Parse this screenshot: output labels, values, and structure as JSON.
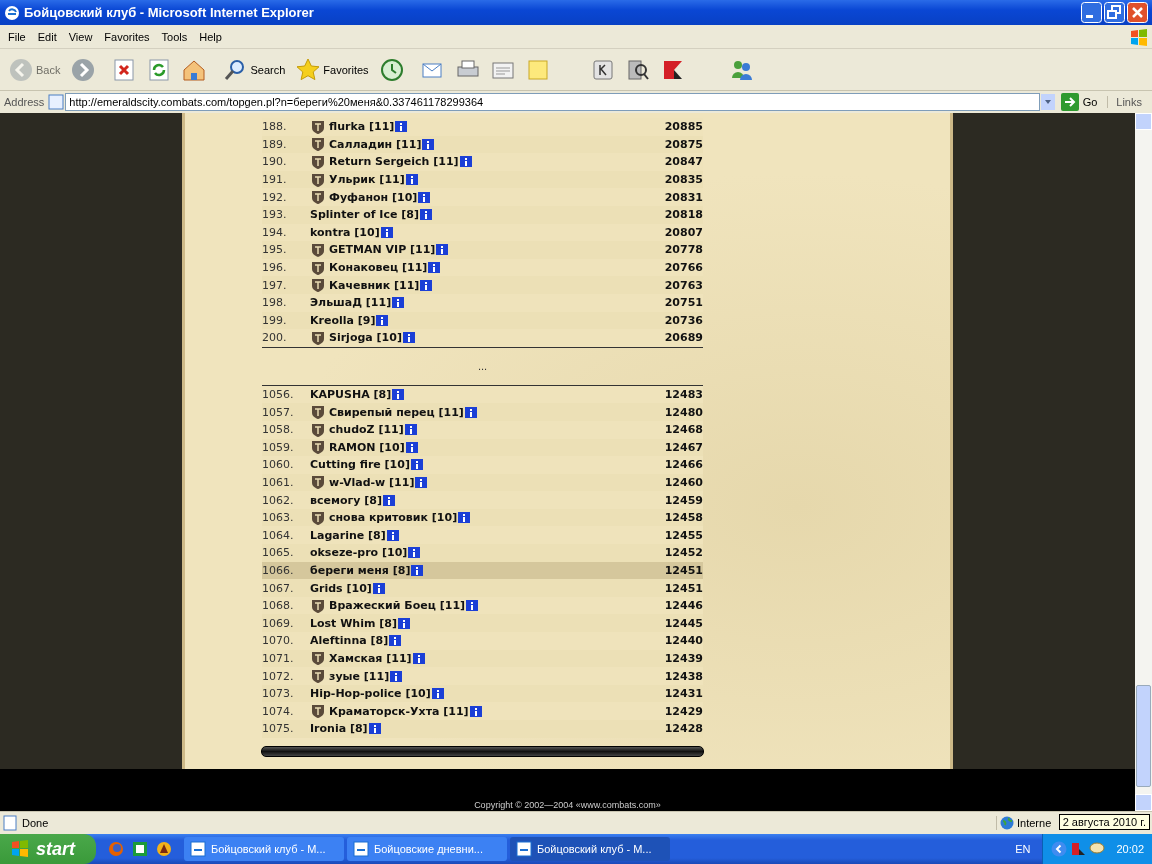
{
  "window": {
    "title": "Бойцовский клуб - Microsoft Internet Explorer"
  },
  "menu": [
    "File",
    "Edit",
    "View",
    "Favorites",
    "Tools",
    "Help"
  ],
  "toolbar": [
    {
      "kind": "back",
      "label": "Back",
      "disabled": true
    },
    {
      "kind": "forward",
      "disabled": false
    },
    {
      "kind": "stop",
      "disabled": false
    },
    {
      "kind": "refresh",
      "disabled": false
    },
    {
      "kind": "home",
      "disabled": false
    },
    {
      "kind": "search",
      "label": "Search",
      "disabled": false
    },
    {
      "kind": "favorites",
      "label": "Favorites",
      "disabled": false
    },
    {
      "kind": "history",
      "disabled": false
    },
    {
      "kind": "mail",
      "disabled": false
    },
    {
      "kind": "print",
      "disabled": false
    },
    {
      "kind": "edit",
      "disabled": false
    },
    {
      "kind": "note",
      "disabled": false
    },
    {
      "kind": "k",
      "disabled": false
    },
    {
      "kind": "magnifier",
      "disabled": false
    },
    {
      "kind": "antivirus",
      "disabled": false
    },
    {
      "kind": "messenger",
      "disabled": false
    }
  ],
  "address": {
    "label": "Address",
    "value": "http://emeraldscity.combats.com/topgen.pl?n=береги%20меня&0.337461178299364",
    "go": "Go",
    "links": "Links"
  },
  "ranking": {
    "top_rows": [
      {
        "rank": "188.",
        "name": "flurka [11]",
        "emblem": true,
        "selected": false,
        "score": "20885"
      },
      {
        "rank": "189.",
        "name": "Салладин [11]",
        "emblem": true,
        "selected": false,
        "score": "20875"
      },
      {
        "rank": "190.",
        "name": "Return Sergeich [11]",
        "emblem": true,
        "selected": false,
        "score": "20847"
      },
      {
        "rank": "191.",
        "name": "Ульрик [11]",
        "emblem": true,
        "selected": false,
        "score": "20835"
      },
      {
        "rank": "192.",
        "name": "Фуфанон [10]",
        "emblem": true,
        "selected": false,
        "score": "20831"
      },
      {
        "rank": "193.",
        "name": "Splinter of Ice [8]",
        "emblem": false,
        "selected": false,
        "score": "20818"
      },
      {
        "rank": "194.",
        "name": "kontra [10]",
        "emblem": false,
        "selected": false,
        "score": "20807"
      },
      {
        "rank": "195.",
        "name": "GETMAN VIP [11]",
        "emblem": true,
        "selected": false,
        "score": "20778"
      },
      {
        "rank": "196.",
        "name": "Конаковец [11]",
        "emblem": true,
        "selected": false,
        "score": "20766"
      },
      {
        "rank": "197.",
        "name": "Качевник [11]",
        "emblem": true,
        "selected": false,
        "score": "20763"
      },
      {
        "rank": "198.",
        "name": "ЭльшаД [11]",
        "emblem": false,
        "selected": false,
        "score": "20751"
      },
      {
        "rank": "199.",
        "name": "Kreolla [9]",
        "emblem": false,
        "selected": false,
        "score": "20736"
      },
      {
        "rank": "200.",
        "name": "Sirjoga [10]",
        "emblem": true,
        "selected": false,
        "score": "20689"
      }
    ],
    "ellipsis": "...",
    "bottom_rows": [
      {
        "rank": "1056.",
        "name": "KAPUSHA [8]",
        "emblem": false,
        "selected": false,
        "score": "12483"
      },
      {
        "rank": "1057.",
        "name": "Свирепый перец [11]",
        "emblem": true,
        "selected": false,
        "score": "12480"
      },
      {
        "rank": "1058.",
        "name": "chudoZ [11]",
        "emblem": true,
        "selected": false,
        "score": "12468"
      },
      {
        "rank": "1059.",
        "name": "RAMON [10]",
        "emblem": true,
        "selected": false,
        "score": "12467"
      },
      {
        "rank": "1060.",
        "name": "Cutting fire [10]",
        "emblem": false,
        "selected": false,
        "score": "12466"
      },
      {
        "rank": "1061.",
        "name": "w-Vlad-w [11]",
        "emblem": true,
        "selected": false,
        "score": "12460"
      },
      {
        "rank": "1062.",
        "name": "всемогу [8]",
        "emblem": false,
        "selected": false,
        "score": "12459"
      },
      {
        "rank": "1063.",
        "name": "снова критовик [10]",
        "emblem": true,
        "selected": false,
        "score": "12458"
      },
      {
        "rank": "1064.",
        "name": "Lagarine [8]",
        "emblem": false,
        "selected": false,
        "score": "12455"
      },
      {
        "rank": "1065.",
        "name": "okseze-pro [10]",
        "emblem": false,
        "selected": false,
        "score": "12452"
      },
      {
        "rank": "1066.",
        "name": "береги меня [8]",
        "emblem": false,
        "selected": true,
        "score": "12451"
      },
      {
        "rank": "1067.",
        "name": "Grids [10]",
        "emblem": false,
        "selected": false,
        "score": "12451"
      },
      {
        "rank": "1068.",
        "name": "Вражеский Боец [11]",
        "emblem": true,
        "selected": false,
        "score": "12446"
      },
      {
        "rank": "1069.",
        "name": "Lost Whim [8]",
        "emblem": false,
        "selected": false,
        "score": "12445"
      },
      {
        "rank": "1070.",
        "name": "Aleftinna [8]",
        "emblem": false,
        "selected": false,
        "score": "12440"
      },
      {
        "rank": "1071.",
        "name": "Хамская [11]",
        "emblem": true,
        "selected": false,
        "score": "12439"
      },
      {
        "rank": "1072.",
        "name": "зуые [11]",
        "emblem": true,
        "selected": false,
        "score": "12438"
      },
      {
        "rank": "1073.",
        "name": "Hip-Hop-police [10]",
        "emblem": false,
        "selected": false,
        "score": "12431"
      },
      {
        "rank": "1074.",
        "name": "Краматорск-Ухта [11]",
        "emblem": true,
        "selected": false,
        "score": "12429"
      },
      {
        "rank": "1075.",
        "name": "Ironia [8]",
        "emblem": false,
        "selected": false,
        "score": "12428"
      }
    ]
  },
  "footer": {
    "copyright": "Copyright © 2002—2004 «www.combats.com»"
  },
  "status_bar": {
    "text": "Done",
    "zone": "Interne"
  },
  "tooltip": "2 августа 2010 г.",
  "taskbar": {
    "start": "start",
    "tasks": [
      {
        "label": "Бойцовский клуб - М...",
        "selected": false
      },
      {
        "label": "Бойцовские дневни...",
        "selected": false
      },
      {
        "label": "Бойцовский клуб - М...",
        "selected": true
      }
    ],
    "language": "EN",
    "clock": "20:02"
  }
}
